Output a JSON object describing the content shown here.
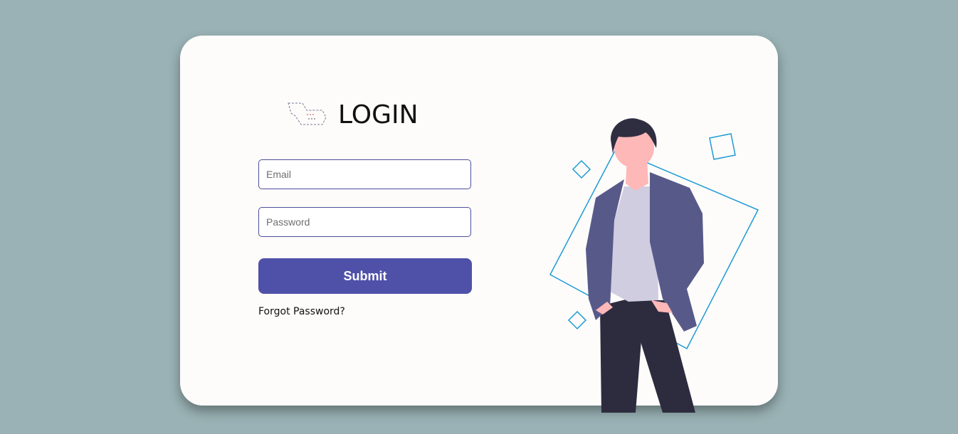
{
  "login": {
    "title": "LOGIN",
    "email_placeholder": "Email",
    "password_placeholder": "Password",
    "submit_label": "Submit",
    "forgot_label": "Forgot Password?"
  },
  "colors": {
    "background": "#9ab2b5",
    "card": "#fdfcfa",
    "accent": "#4f51a8",
    "input_border": "#4e4f9a",
    "illustration_outline": "#1e9ad6"
  },
  "icons": {
    "logo": "login-logo-icon",
    "illustration": "standing-person-illustration"
  }
}
